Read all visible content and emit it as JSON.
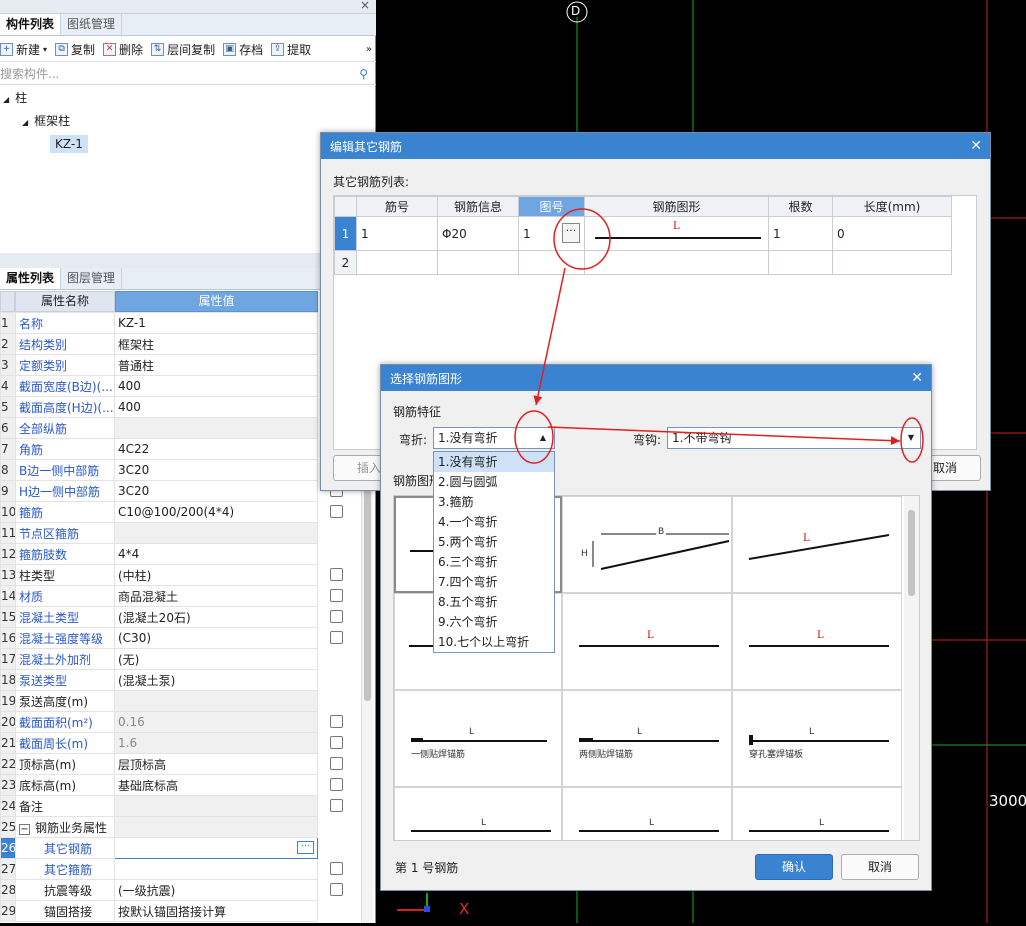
{
  "left": {
    "top_tabs": [
      "构件列表",
      "图纸管理"
    ],
    "toolbar": {
      "new": "新建",
      "copy": "复制",
      "delete": "删除",
      "floor_copy": "层间复制",
      "save": "存档",
      "extract": "提取"
    },
    "search_placeholder": "搜索构件...",
    "tree": {
      "root": "柱",
      "child": "框架柱",
      "leaf": "KZ-1"
    },
    "prop_tabs": [
      "属性列表",
      "图层管理"
    ],
    "prop_header": {
      "name": "属性名称",
      "value": "属性值"
    },
    "props": [
      {
        "n": "1",
        "k": "名称",
        "v": "KZ-1"
      },
      {
        "n": "2",
        "k": "结构类别",
        "v": "框架柱"
      },
      {
        "n": "3",
        "k": "定额类别",
        "v": "普通柱"
      },
      {
        "n": "4",
        "k": "截面宽度(B边)(...",
        "v": "400"
      },
      {
        "n": "5",
        "k": "截面高度(H边)(...",
        "v": "400"
      },
      {
        "n": "6",
        "k": "全部纵筋",
        "v": ""
      },
      {
        "n": "7",
        "k": "角筋",
        "v": "4C22"
      },
      {
        "n": "8",
        "k": "B边一侧中部筋",
        "v": "3C20"
      },
      {
        "n": "9",
        "k": "H边一侧中部筋",
        "v": "3C20"
      },
      {
        "n": "10",
        "k": "箍筋",
        "v": "C10@100/200(4*4)"
      },
      {
        "n": "11",
        "k": "节点区箍筋",
        "v": ""
      },
      {
        "n": "12",
        "k": "箍筋肢数",
        "v": "4*4"
      },
      {
        "n": "13",
        "k": "柱类型",
        "v": "(中柱)"
      },
      {
        "n": "14",
        "k": "材质",
        "v": "商品混凝土"
      },
      {
        "n": "15",
        "k": "混凝土类型",
        "v": "(混凝土20石)"
      },
      {
        "n": "16",
        "k": "混凝土强度等级",
        "v": "(C30)"
      },
      {
        "n": "17",
        "k": "混凝土外加剂",
        "v": "(无)"
      },
      {
        "n": "18",
        "k": "泵送类型",
        "v": "(混凝土泵)"
      },
      {
        "n": "19",
        "k": "泵送高度(m)",
        "v": ""
      },
      {
        "n": "20",
        "k": "截面面积(m²)",
        "v": "0.16"
      },
      {
        "n": "21",
        "k": "截面周长(m)",
        "v": "1.6"
      },
      {
        "n": "22",
        "k": "顶标高(m)",
        "v": "层顶标高"
      },
      {
        "n": "23",
        "k": "底标高(m)",
        "v": "基础底标高"
      },
      {
        "n": "24",
        "k": "备注",
        "v": ""
      },
      {
        "n": "25",
        "k": "钢筋业务属性",
        "v": ""
      },
      {
        "n": "26",
        "k": "其它钢筋",
        "v": ""
      },
      {
        "n": "27",
        "k": "其它箍筋",
        "v": ""
      },
      {
        "n": "28",
        "k": "抗震等级",
        "v": "(一级抗震)"
      },
      {
        "n": "29",
        "k": "锚固搭接",
        "v": "按默认锚固搭接计算"
      }
    ]
  },
  "cad": {
    "axis_label": "D",
    "dimension": "3000",
    "x_axis": "X"
  },
  "edit_dialog": {
    "title": "编辑其它钢筋",
    "list_label": "其它钢筋列表:",
    "columns": [
      "筋号",
      "钢筋信息",
      "图号",
      "钢筋图形",
      "根数",
      "长度(mm)"
    ],
    "row1": {
      "num": "1",
      "jinhao": "1",
      "info": "Φ20",
      "tuhao": "1",
      "shape_label": "L",
      "count": "1",
      "length": "0"
    },
    "row2_num": "2",
    "insert_btn": "插入",
    "cancel_btn": "取消"
  },
  "select_dialog": {
    "title": "选择钢筋图形",
    "feature_label": "钢筋特征",
    "bend_label": "弯折:",
    "bend_value": "1.没有弯折",
    "hook_label": "弯钩:",
    "hook_value": "1.不带弯钩",
    "shapes_label": "钢筋图形",
    "options": [
      "1.没有弯折",
      "2.圆与圆弧",
      "3.箍筋",
      "4.一个弯折",
      "5.两个弯折",
      "6.三个弯折",
      "7.四个弯折",
      "8.五个弯折",
      "9.六个弯折",
      "10.七个以上弯折"
    ],
    "shape_labels": {
      "L": "L",
      "B": "B",
      "H": "H"
    },
    "shape_captions": [
      "一侧贴焊锚筋",
      "两侧贴焊锚筋",
      "穿孔塞焊锚板"
    ],
    "footer_text": "第 1 号钢筋",
    "ok": "确认",
    "cancel": "取消"
  }
}
